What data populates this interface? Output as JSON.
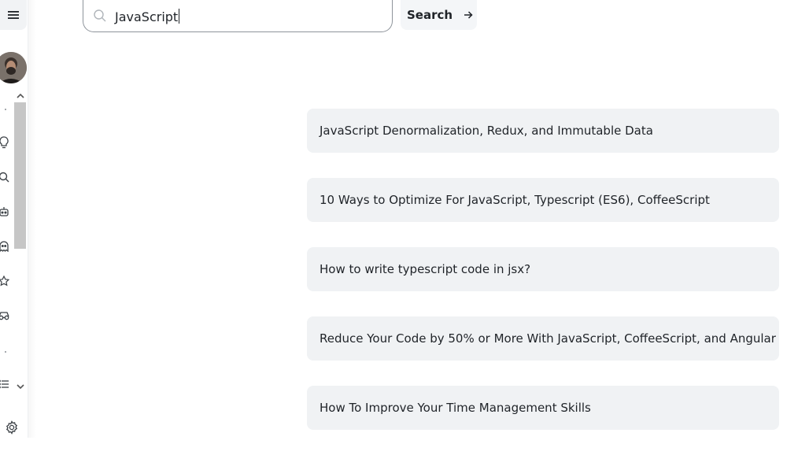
{
  "search": {
    "value": "JavaScript",
    "button_label": "Search"
  },
  "results": [
    {
      "title": "JavaScript Denormalization, Redux, and Immutable Data"
    },
    {
      "title": "10 Ways to Optimize For JavaScript, Typescript (ES6), CoffeeScript"
    },
    {
      "title": "How to write typescript code in jsx?"
    },
    {
      "title": "Reduce Your Code by 50% or More With JavaScript, CoffeeScript, and Angular"
    },
    {
      "title": "How To Improve Your Time Management Skills"
    }
  ],
  "sidebar": {
    "icons": [
      "lightbulb-icon",
      "search-icon",
      "robot-icon",
      "ghost-icon",
      "star-icon",
      "glasses-icon",
      "list-icon"
    ]
  },
  "colors": {
    "card_background": "#f0f2f4",
    "border": "#8e949b",
    "text": "#1f2328"
  }
}
